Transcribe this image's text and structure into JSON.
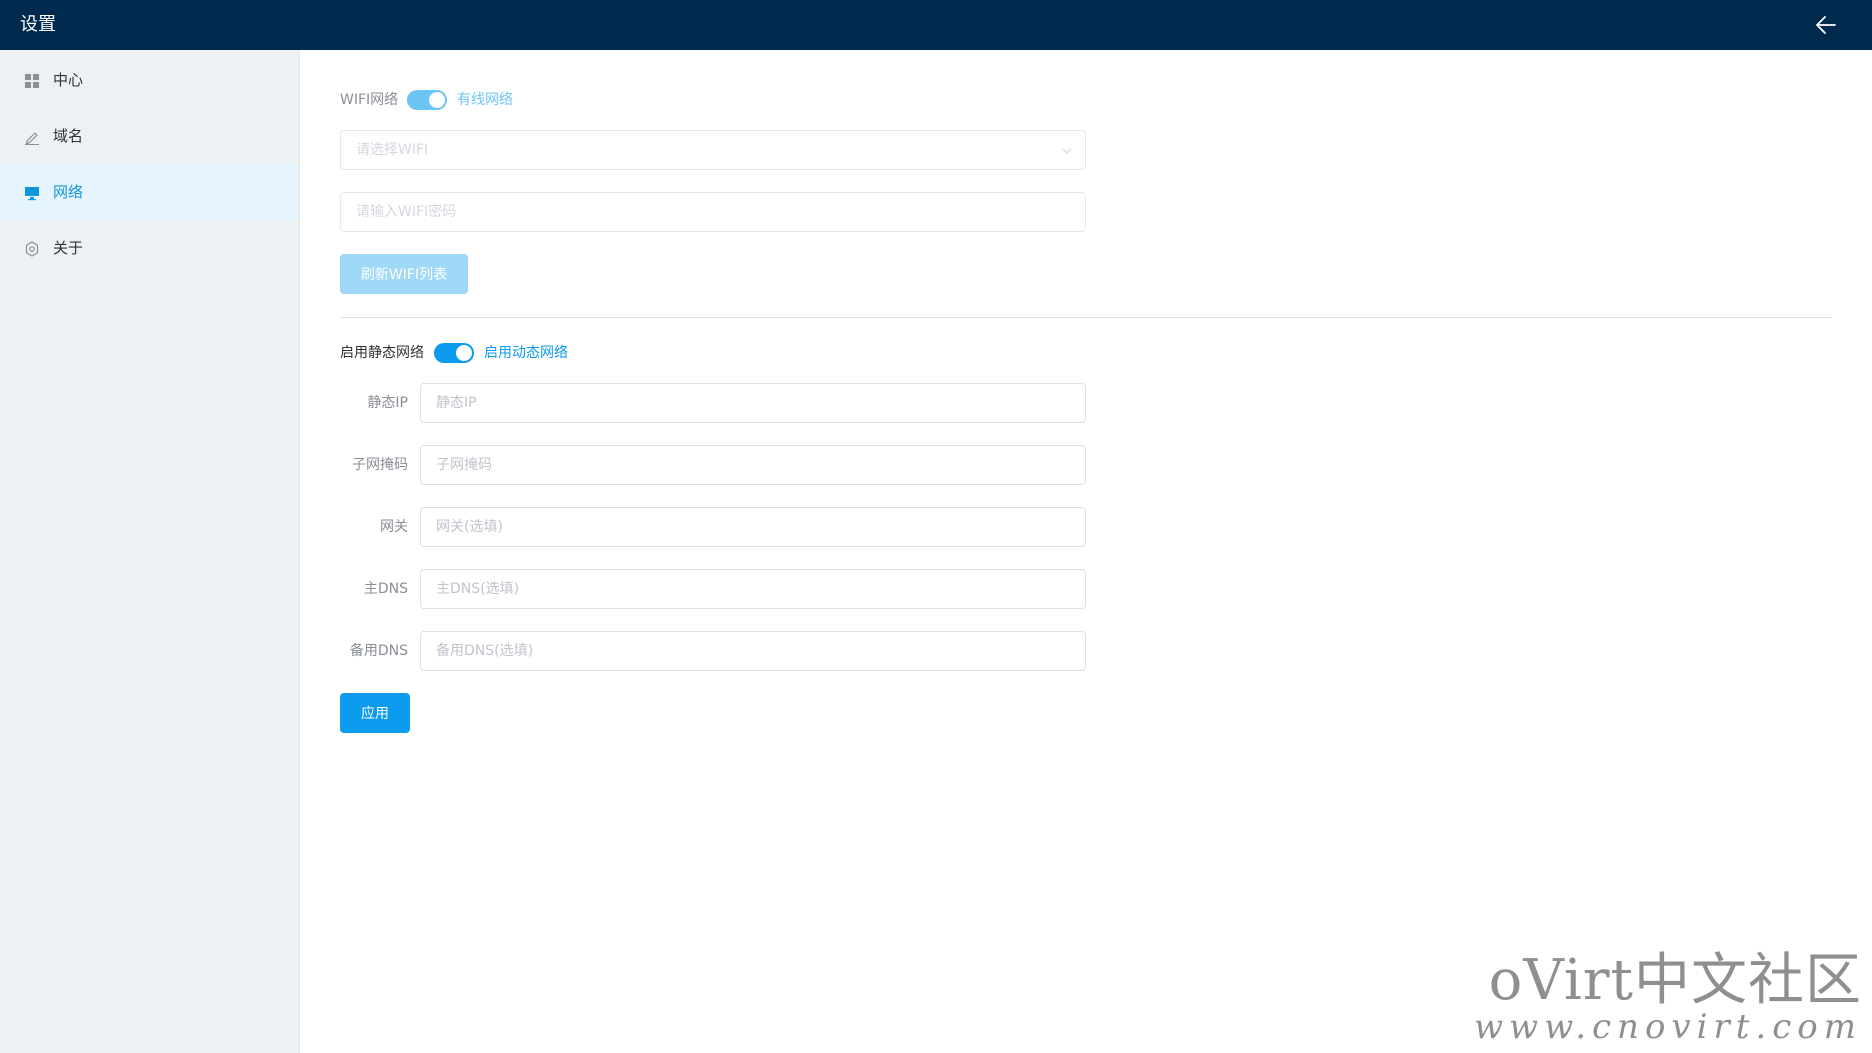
{
  "header": {
    "title": "设置"
  },
  "sidebar": {
    "items": [
      {
        "label": "中心",
        "icon": "grid-icon",
        "active": false
      },
      {
        "label": "域名",
        "icon": "pencil-icon",
        "active": false
      },
      {
        "label": "网络",
        "icon": "monitor-icon",
        "active": true
      },
      {
        "label": "关于",
        "icon": "gear-icon",
        "active": false
      }
    ]
  },
  "wifi": {
    "switch_label_left": "WIFI网络",
    "switch_label_right": "有线网络",
    "switch_on": true,
    "select_placeholder": "请选择WIFI",
    "password_placeholder": "请输入WIFI密码",
    "refresh_button": "刷新WIFI列表"
  },
  "static": {
    "switch_label_left": "启用静态网络",
    "switch_label_right": "启用动态网络",
    "switch_on": true,
    "fields": [
      {
        "label": "静态IP",
        "placeholder": "静态IP"
      },
      {
        "label": "子网掩码",
        "placeholder": "子网掩码"
      },
      {
        "label": "网关",
        "placeholder": "网关(选填)"
      },
      {
        "label": "主DNS",
        "placeholder": "主DNS(选填)"
      },
      {
        "label": "备用DNS",
        "placeholder": "备用DNS(选填)"
      }
    ],
    "apply_button": "应用"
  },
  "watermark": {
    "title": "oVirt中文社区",
    "url": "www.cnovirt.com"
  },
  "colors": {
    "header_bg": "#002a4d",
    "sidebar_bg": "#eef1f4",
    "accent": "#0c9bee",
    "accent_light": "#a0d8f7"
  }
}
